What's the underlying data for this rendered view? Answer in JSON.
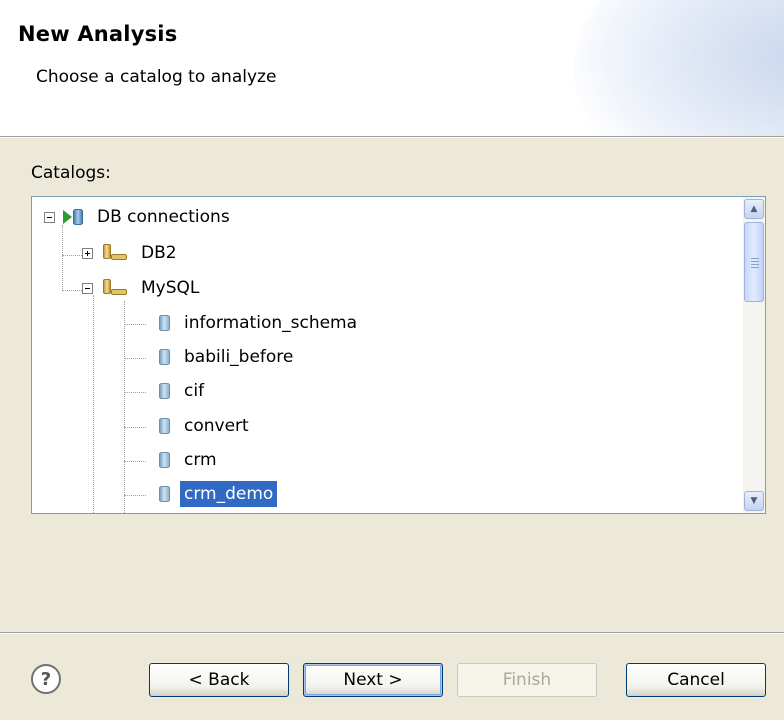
{
  "header": {
    "title": "New Analysis",
    "subtitle": "Choose a catalog to analyze"
  },
  "catalogs": {
    "label": "Catalogs:",
    "tree": {
      "root": {
        "label": "DB connections",
        "expanded": true,
        "icon": "db-connections-icon"
      },
      "servers": [
        {
          "label": "DB2",
          "expanded": false,
          "icon": "server-icon"
        },
        {
          "label": "MySQL",
          "expanded": true,
          "icon": "server-icon"
        }
      ],
      "catalog_items": [
        {
          "label": "information_schema",
          "icon": "database-icon"
        },
        {
          "label": "babili_before",
          "icon": "database-icon"
        },
        {
          "label": "cif",
          "icon": "database-icon"
        },
        {
          "label": "convert",
          "icon": "database-icon"
        },
        {
          "label": "crm",
          "icon": "database-icon"
        },
        {
          "label": "crm_demo",
          "icon": "database-icon",
          "selected": true
        }
      ]
    }
  },
  "footer": {
    "help_glyph": "?",
    "back_label": "< Back",
    "next_label": "Next >",
    "finish_label": "Finish",
    "cancel_label": "Cancel"
  },
  "colors": {
    "selection": "#316ac5",
    "dialog_bg": "#ece9d8",
    "button_border": "#003c74"
  }
}
